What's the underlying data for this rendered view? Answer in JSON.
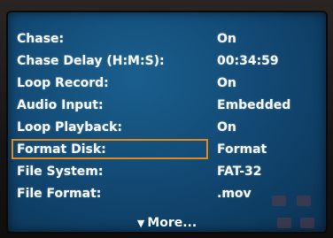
{
  "menu": {
    "items": [
      {
        "label": "Chase:",
        "value": "On"
      },
      {
        "label": "Chase Delay (H:M:S):",
        "value": "00:34:59"
      },
      {
        "label": "Loop Record:",
        "value": "On"
      },
      {
        "label": "Audio Input:",
        "value": "Embedded"
      },
      {
        "label": "Loop Playback:",
        "value": "On"
      },
      {
        "label": "Format Disk:",
        "value": "Format"
      },
      {
        "label": "File System:",
        "value": "FAT-32"
      },
      {
        "label": "File Format:",
        "value": ".mov"
      }
    ],
    "selected_index": 5,
    "more_label": "More...",
    "more_icon": "down-triangle-icon"
  },
  "colors": {
    "screen_background": "#114670",
    "text": "#f2f5ef",
    "selection_border": "#e38a1d"
  }
}
